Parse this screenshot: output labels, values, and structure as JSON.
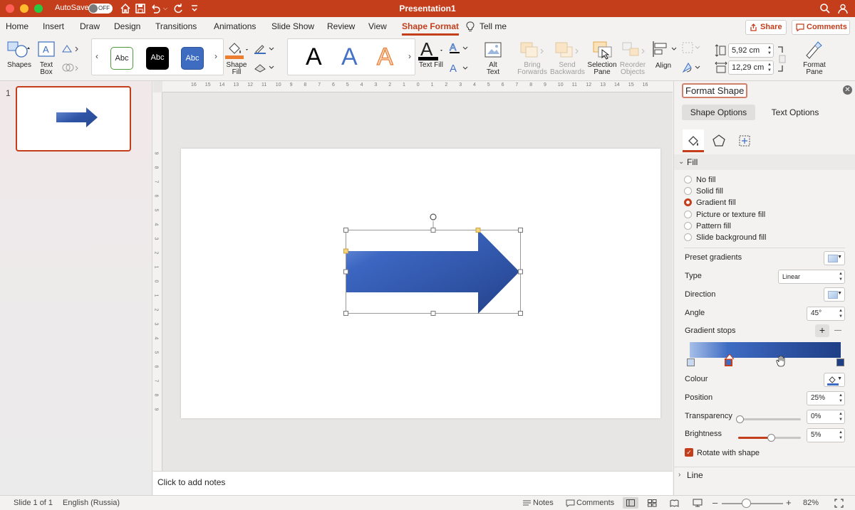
{
  "titlebar": {
    "autosave_label": "AutoSave",
    "autosave_state": "OFF",
    "doc_title": "Presentation1"
  },
  "tabs": [
    {
      "label": "Home"
    },
    {
      "label": "Insert"
    },
    {
      "label": "Draw"
    },
    {
      "label": "Design"
    },
    {
      "label": "Transitions"
    },
    {
      "label": "Animations"
    },
    {
      "label": "Slide Show"
    },
    {
      "label": "Review"
    },
    {
      "label": "View"
    },
    {
      "label": "Shape Format",
      "active": true
    },
    {
      "label": "Tell me"
    }
  ],
  "header_buttons": {
    "share": "Share",
    "comments": "Comments"
  },
  "ribbon": {
    "shapes": "Shapes",
    "text_box_1": "Text",
    "text_box_2": "Box",
    "style_abc": [
      "Abc",
      "Abc",
      "Abc"
    ],
    "shape_fill_1": "Shape",
    "shape_fill_2": "Fill",
    "wordart": [
      "A",
      "A",
      "A"
    ],
    "text_fill": "Text Fill",
    "alt_text_1": "Alt",
    "alt_text_2": "Text",
    "bring_forwards_1": "Bring",
    "bring_forwards_2": "Forwards",
    "send_backwards_1": "Send",
    "send_backwards_2": "Backwards",
    "selection_pane_1": "Selection",
    "selection_pane_2": "Pane",
    "reorder_objects_1": "Reorder",
    "reorder_objects_2": "Objects",
    "align": "Align",
    "height_value": "5,92 cm",
    "width_value": "12,29 cm",
    "format_pane_1": "Format",
    "format_pane_2": "Pane"
  },
  "thumbnails": {
    "slide_number": "1"
  },
  "ruler": {
    "h_labels": [
      "16",
      "15",
      "14",
      "13",
      "12",
      "11",
      "10",
      "9",
      "8",
      "7",
      "6",
      "5",
      "4",
      "3",
      "2",
      "1",
      "0",
      "1",
      "2",
      "3",
      "4",
      "5",
      "6",
      "7",
      "8",
      "9",
      "10",
      "11",
      "12",
      "13",
      "14",
      "15",
      "16"
    ],
    "v_labels": [
      "9",
      "8",
      "7",
      "6",
      "5",
      "4",
      "3",
      "2",
      "1",
      "0",
      "1",
      "2",
      "3",
      "4",
      "5",
      "6",
      "7",
      "8",
      "9"
    ]
  },
  "notes": {
    "placeholder": "Click to add notes"
  },
  "pane": {
    "title": "Format Shape",
    "tab_shape_options": "Shape Options",
    "tab_text_options": "Text Options",
    "fill_section": "Fill",
    "fill_options": [
      {
        "label": "No fill",
        "selected": false
      },
      {
        "label": "Solid fill",
        "selected": false
      },
      {
        "label": "Gradient fill",
        "selected": true
      },
      {
        "label": "Picture or texture fill",
        "selected": false
      },
      {
        "label": "Pattern fill",
        "selected": false
      },
      {
        "label": "Slide background fill",
        "selected": false
      }
    ],
    "preset_gradients": "Preset gradients",
    "type_label": "Type",
    "type_value": "Linear",
    "direction_label": "Direction",
    "angle_label": "Angle",
    "angle_value": "45°",
    "gradient_stops_label": "Gradient stops",
    "add_stop": "+",
    "remove_stop": "—",
    "colour_label": "Colour",
    "position_label": "Position",
    "position_value": "25%",
    "transparency_label": "Transparency",
    "transparency_value": "0%",
    "transparency_level": 0,
    "brightness_label": "Brightness",
    "brightness_value": "5%",
    "brightness_level": 0.52,
    "rotate_with_shape": "Rotate with shape",
    "line_section": "Line"
  },
  "status": {
    "slide_info": "Slide 1 of 1",
    "language": "English (Russia)",
    "notes": "Notes",
    "comments": "Comments",
    "zoom": "82%"
  },
  "colors": {
    "accent": "#c43e1c",
    "arrow_dark": "#2f54a6",
    "arrow_light": "#5b82cf"
  }
}
